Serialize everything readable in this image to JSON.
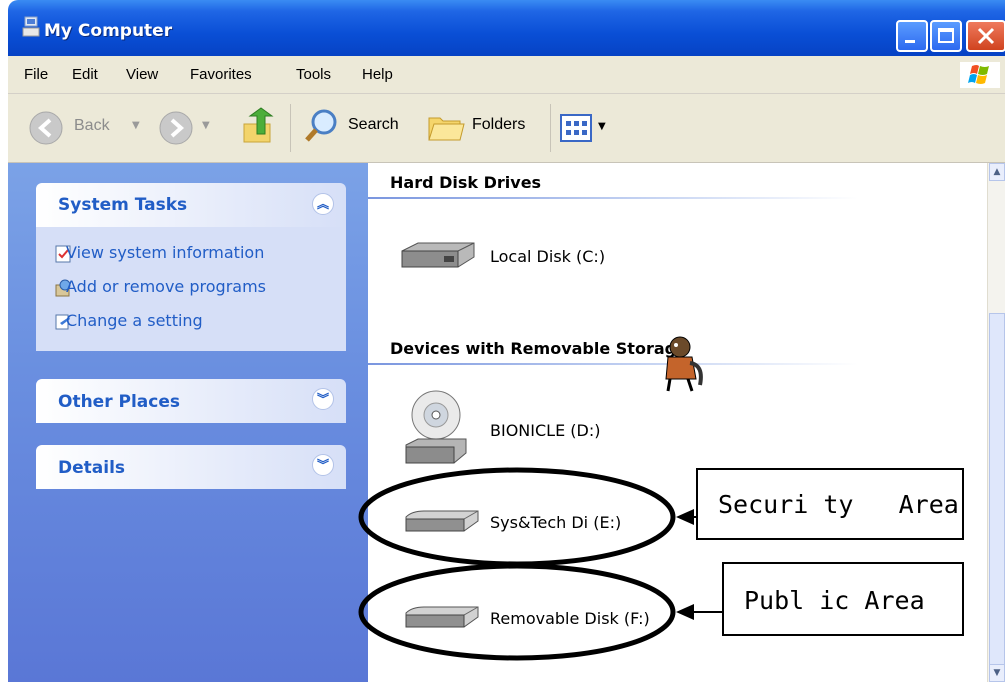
{
  "window": {
    "title": "My Computer"
  },
  "menu": {
    "items": [
      "File",
      "Edit",
      "View",
      "Favorites",
      "Tools",
      "Help"
    ]
  },
  "toolbar": {
    "back_label": "Back",
    "search_label": "Search",
    "folders_label": "Folders"
  },
  "sidebar": {
    "system_tasks": {
      "title": "System Tasks",
      "items": [
        "View system information",
        "Add or remove programs",
        "Change a setting"
      ]
    },
    "other_places": {
      "title": "Other Places"
    },
    "details": {
      "title": "Details"
    }
  },
  "content": {
    "hard_disk_group": "Hard Disk Drives",
    "removable_group": "Devices with Removable Storage",
    "drives": {
      "c": "Local Disk (C:)",
      "d": "BIONICLE (D:)",
      "e": "Sys&Tech Di (E:)",
      "f": "Removable Disk (F:)"
    }
  },
  "annotations": {
    "security": "Securi ty   Area",
    "public": "Publ ic Area"
  },
  "colors": {
    "titlebar": "#0a4fd6",
    "sidebar": "#6a8fe0",
    "link": "#215dc6",
    "chrome": "#ece9d8"
  }
}
